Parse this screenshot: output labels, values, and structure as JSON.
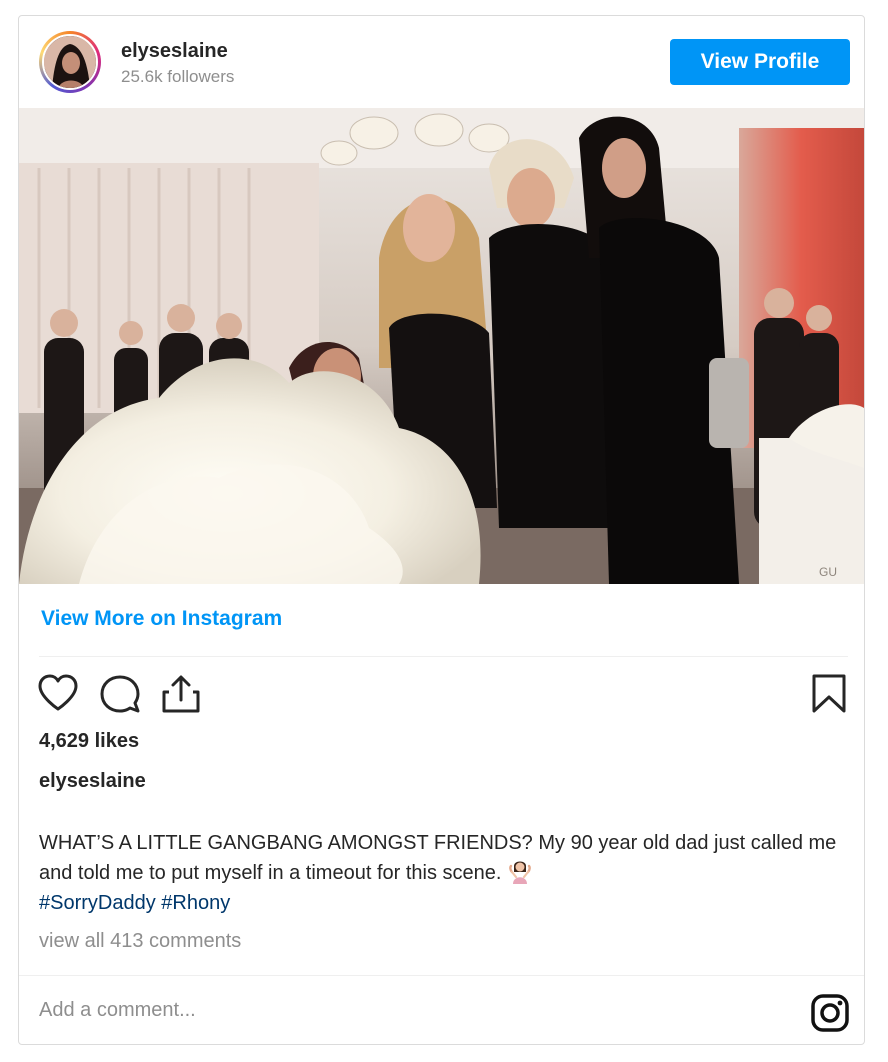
{
  "post": {
    "username": "elyseslaine",
    "followers": "25.6k followers",
    "view_profile_label": "View Profile",
    "view_more_label": "View More on Instagram",
    "likes": "4,629 likes",
    "author": "elyseslaine",
    "caption_text": "WHAT’S A LITTLE GANGBANG AMONGST FRIENDS? My 90 year old dad just called me and told me to put myself in a timeout for this scene.",
    "caption_emoji": "woman-shrugging-emoji",
    "hashtag_1": "#SorryDaddy",
    "hashtag_2": "#Rhony",
    "view_comments": "view all 413 comments",
    "comment_placeholder": "Add a comment...",
    "photo_watermark": "GU"
  },
  "icons": {
    "like": "heart-icon",
    "comment": "comment-bubble-icon",
    "share": "share-upload-icon",
    "save": "bookmark-icon",
    "instagram": "instagram-logo-icon"
  },
  "colors": {
    "accent": "#0095f6",
    "hashtag": "#00376b",
    "secondary_text": "#8e8e8e",
    "primary_text": "#262626",
    "border": "#dbdbdb"
  }
}
